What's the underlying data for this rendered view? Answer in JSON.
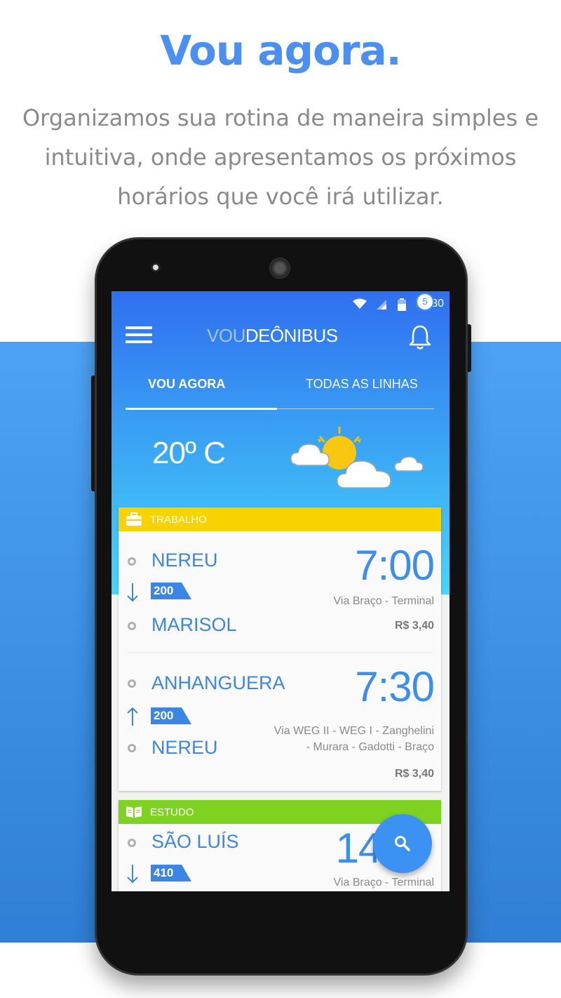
{
  "promo": {
    "headline": "Vou agora.",
    "subtitle": "Organizamos sua rotina de maneira simples e intuitiva, onde apresentamos os próximos horários que você irá utilizar."
  },
  "status_bar": {
    "time": "12:30"
  },
  "app": {
    "brand_light": "VOU",
    "brand_main": "DEÔNIBUS",
    "notification_count": "5"
  },
  "tabs": [
    {
      "label": "VOU AGORA",
      "active": true
    },
    {
      "label": "TODAS AS LINHAS",
      "active": false
    }
  ],
  "weather": {
    "temperature": "20º C",
    "icon": "partly-cloudy-icon"
  },
  "groups": [
    {
      "label": "TRABALHO",
      "icon": "briefcase-icon",
      "color": "#f9d300",
      "trips": [
        {
          "from": "NEREU",
          "to": "MARISOL",
          "line": "200",
          "direction": "down",
          "time": "7:00",
          "via": "Via Braço - Terminal",
          "price": "R$ 3,40"
        },
        {
          "from": "ANHANGUERA",
          "to": "NEREU",
          "line": "200",
          "direction": "up",
          "time": "7:30",
          "via_line1": "Via WEG II - WEG I - Zanghelini",
          "via_line2": "- Murara - Gadotti - Braço",
          "price": "R$ 3,40"
        }
      ]
    },
    {
      "label": "ESTUDO",
      "icon": "book-icon",
      "color": "#7ed321",
      "trips": [
        {
          "from": "SÃO LUÍS",
          "line": "410",
          "direction": "down",
          "time": "14:",
          "via": "Via Braço - Terminal"
        }
      ]
    }
  ],
  "colors": {
    "accent": "#3b8ef0",
    "band": "#4da2f5"
  }
}
